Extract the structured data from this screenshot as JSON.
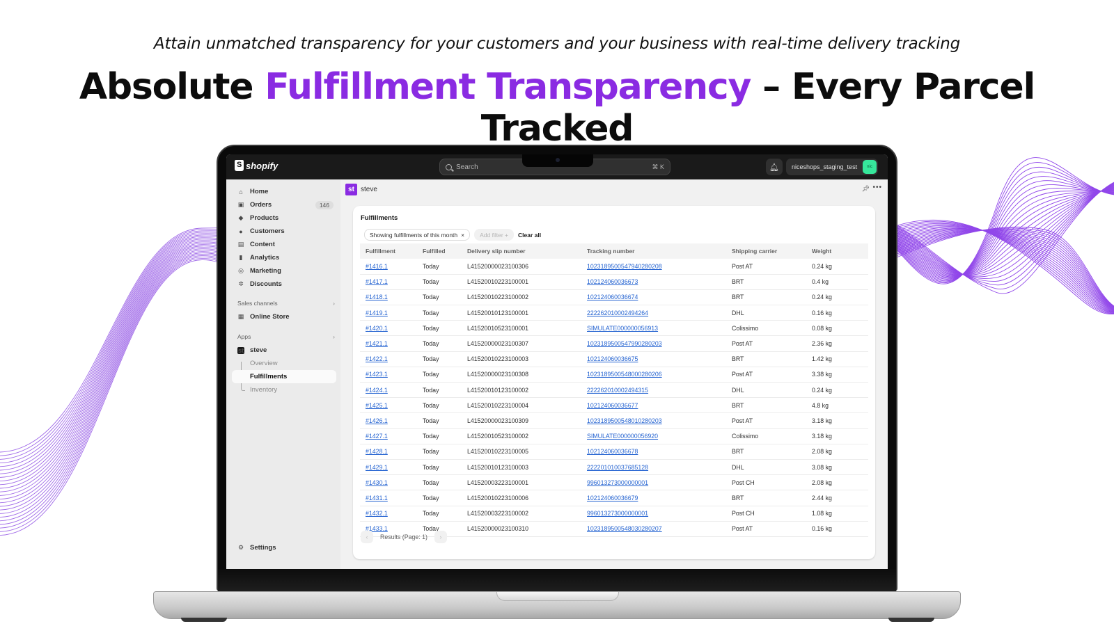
{
  "hero": {
    "tagline": "Attain unmatched transparency for your customers and your business with real-time delivery tracking",
    "headline_pre": "Absolute ",
    "headline_accent": "Fulfillment Transparency",
    "headline_post": " – Every Parcel Tracked",
    "accent_color": "#8a2be2"
  },
  "topbar": {
    "brand": "shopify",
    "search_placeholder": "Search",
    "search_shortcut": "⌘ K",
    "store_name": "niceshops_staging_test",
    "avatar_initials": "nic"
  },
  "sidebar": {
    "items": [
      {
        "label": "Home",
        "icon": "⌂"
      },
      {
        "label": "Orders",
        "icon": "▣",
        "badge": "146"
      },
      {
        "label": "Products",
        "icon": "◆"
      },
      {
        "label": "Customers",
        "icon": "●"
      },
      {
        "label": "Content",
        "icon": "▤"
      },
      {
        "label": "Analytics",
        "icon": "▮"
      },
      {
        "label": "Marketing",
        "icon": "◎"
      },
      {
        "label": "Discounts",
        "icon": "✲"
      }
    ],
    "sales_channels_label": "Sales channels",
    "online_store_label": "Online Store",
    "apps_label": "Apps",
    "app_name": "steve",
    "app_icon": "st",
    "app_sub": [
      "Overview",
      "Fulfillments",
      "Inventory"
    ],
    "settings_label": "Settings"
  },
  "app_header": {
    "icon": "st",
    "name": "steve"
  },
  "card": {
    "title": "Fulfillments",
    "filter_chip": "Showing fulfillments of this month",
    "add_filter": "Add filter +",
    "clear_all": "Clear all",
    "columns": [
      "Fulfillment",
      "Fulfilled",
      "Delivery slip number",
      "Tracking number",
      "Shipping carrier",
      "Weight"
    ],
    "rows": [
      [
        "#1416.1",
        "Today",
        "L41520000023100306",
        "102318950054794028020​8",
        "Post AT",
        "0.24 kg"
      ],
      [
        "#1417.1",
        "Today",
        "L41520010223100001",
        "102124060036673",
        "BRT",
        "0.4 kg"
      ],
      [
        "#1418.1",
        "Today",
        "L41520010223100002",
        "102124060036674",
        "BRT",
        "0.24 kg"
      ],
      [
        "#1419.1",
        "Today",
        "L41520010123100001",
        "222262010002494264",
        "DHL",
        "0.16 kg"
      ],
      [
        "#1420.1",
        "Today",
        "L41520010523100001",
        "SIMULATE000000056913",
        "Colissimo",
        "0.08 kg"
      ],
      [
        "#1421.1",
        "Today",
        "L41520000023100307",
        "1023189500547990280203",
        "Post AT",
        "2.36 kg"
      ],
      [
        "#1422.1",
        "Today",
        "L41520010223100003",
        "102124060036675",
        "BRT",
        "1.42 kg"
      ],
      [
        "#1423.1",
        "Today",
        "L41520000023100308",
        "1023189500548000280206",
        "Post AT",
        "3.38 kg"
      ],
      [
        "#1424.1",
        "Today",
        "L41520010123100002",
        "222262010002494315",
        "DHL",
        "0.24 kg"
      ],
      [
        "#1425.1",
        "Today",
        "L41520010223100004",
        "102124060036677",
        "BRT",
        "4.8 kg"
      ],
      [
        "#1426.1",
        "Today",
        "L41520000023100309",
        "1023189500548010280203",
        "Post AT",
        "3.18 kg"
      ],
      [
        "#1427.1",
        "Today",
        "L41520010523100002",
        "SIMULATE000000056920",
        "Colissimo",
        "3.18 kg"
      ],
      [
        "#1428.1",
        "Today",
        "L41520010223100005",
        "102124060036678",
        "BRT",
        "2.08 kg"
      ],
      [
        "#1429.1",
        "Today",
        "L41520010123100003",
        "222201010037685128",
        "DHL",
        "3.08 kg"
      ],
      [
        "#1430.1",
        "Today",
        "L41520003223100001",
        "996013273000000001",
        "Post CH",
        "2.08 kg"
      ],
      [
        "#1431.1",
        "Today",
        "L41520010223100006",
        "102124060036679",
        "BRT",
        "2.44 kg"
      ],
      [
        "#1432.1",
        "Today",
        "L41520003223100002",
        "996013273000000001",
        "Post CH",
        "1.08 kg"
      ],
      [
        "#1433.1",
        "Today",
        "L41520000023100310",
        "1023189500548030280207",
        "Post AT",
        "0.16 kg"
      ]
    ],
    "pager_label": "Results (Page: 1)"
  }
}
